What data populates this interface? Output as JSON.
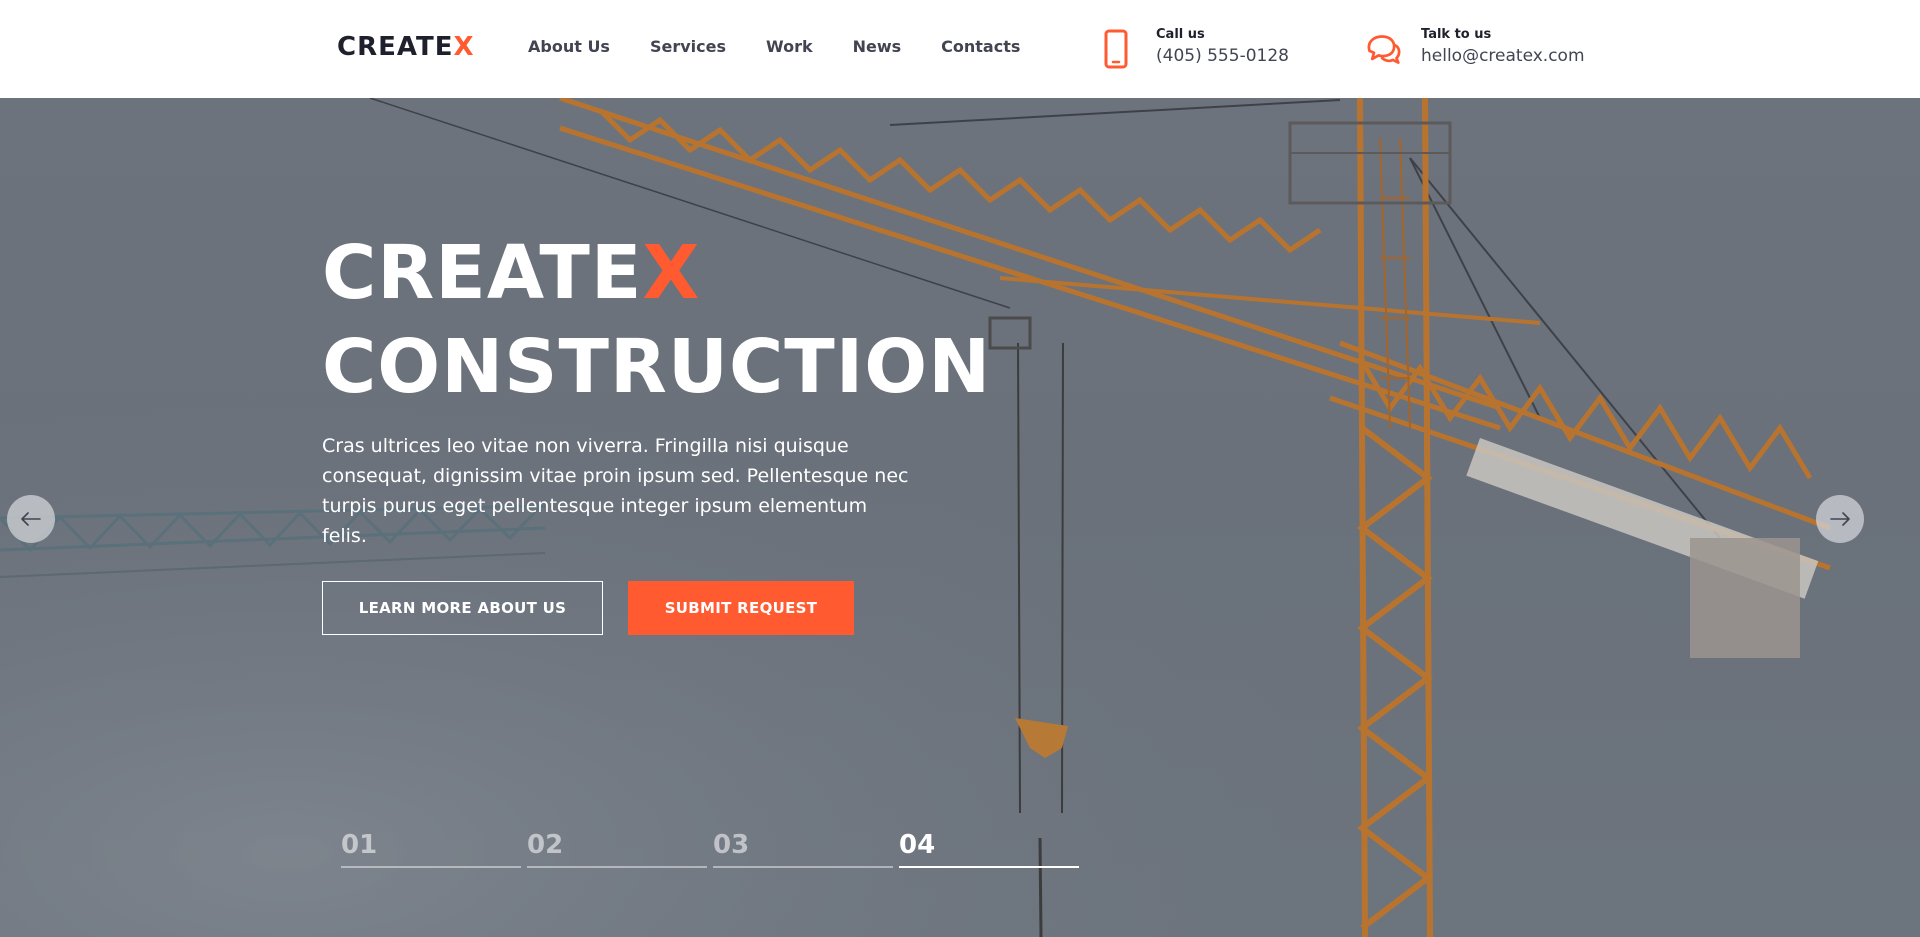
{
  "header": {
    "logo": {
      "text_main": "CREATE",
      "text_accent": "X"
    },
    "nav": [
      "About Us",
      "Services",
      "Work",
      "News",
      "Contacts"
    ],
    "phone": {
      "label": "Call us",
      "value": "(405) 555-0128",
      "icon": "smartphone-icon"
    },
    "email": {
      "label": "Talk to us",
      "value": "hello@createx.com",
      "icon": "chat-bubbles-icon"
    }
  },
  "hero": {
    "title_line1_main": "CREATE",
    "title_line1_accent": "X",
    "title_line2": "CONSTRUCTION",
    "text": "Cras ultrices leo vitae non viverra. Fringilla nisi quisque consequat, dignissim vitae proin ipsum sed. Pellentesque nec turpis purus eget pellentesque integer ipsum elementum felis.",
    "buttons": {
      "learn_more": "LEARN MORE ABOUT US",
      "submit": "SUBMIT REQUEST"
    },
    "slider": {
      "items": [
        "01",
        "02",
        "03",
        "04"
      ],
      "active_index": 3
    }
  },
  "colors": {
    "accent": "#ff5a30",
    "dark": "#1e212c",
    "text": "#424551",
    "crane": "#b8742e"
  }
}
